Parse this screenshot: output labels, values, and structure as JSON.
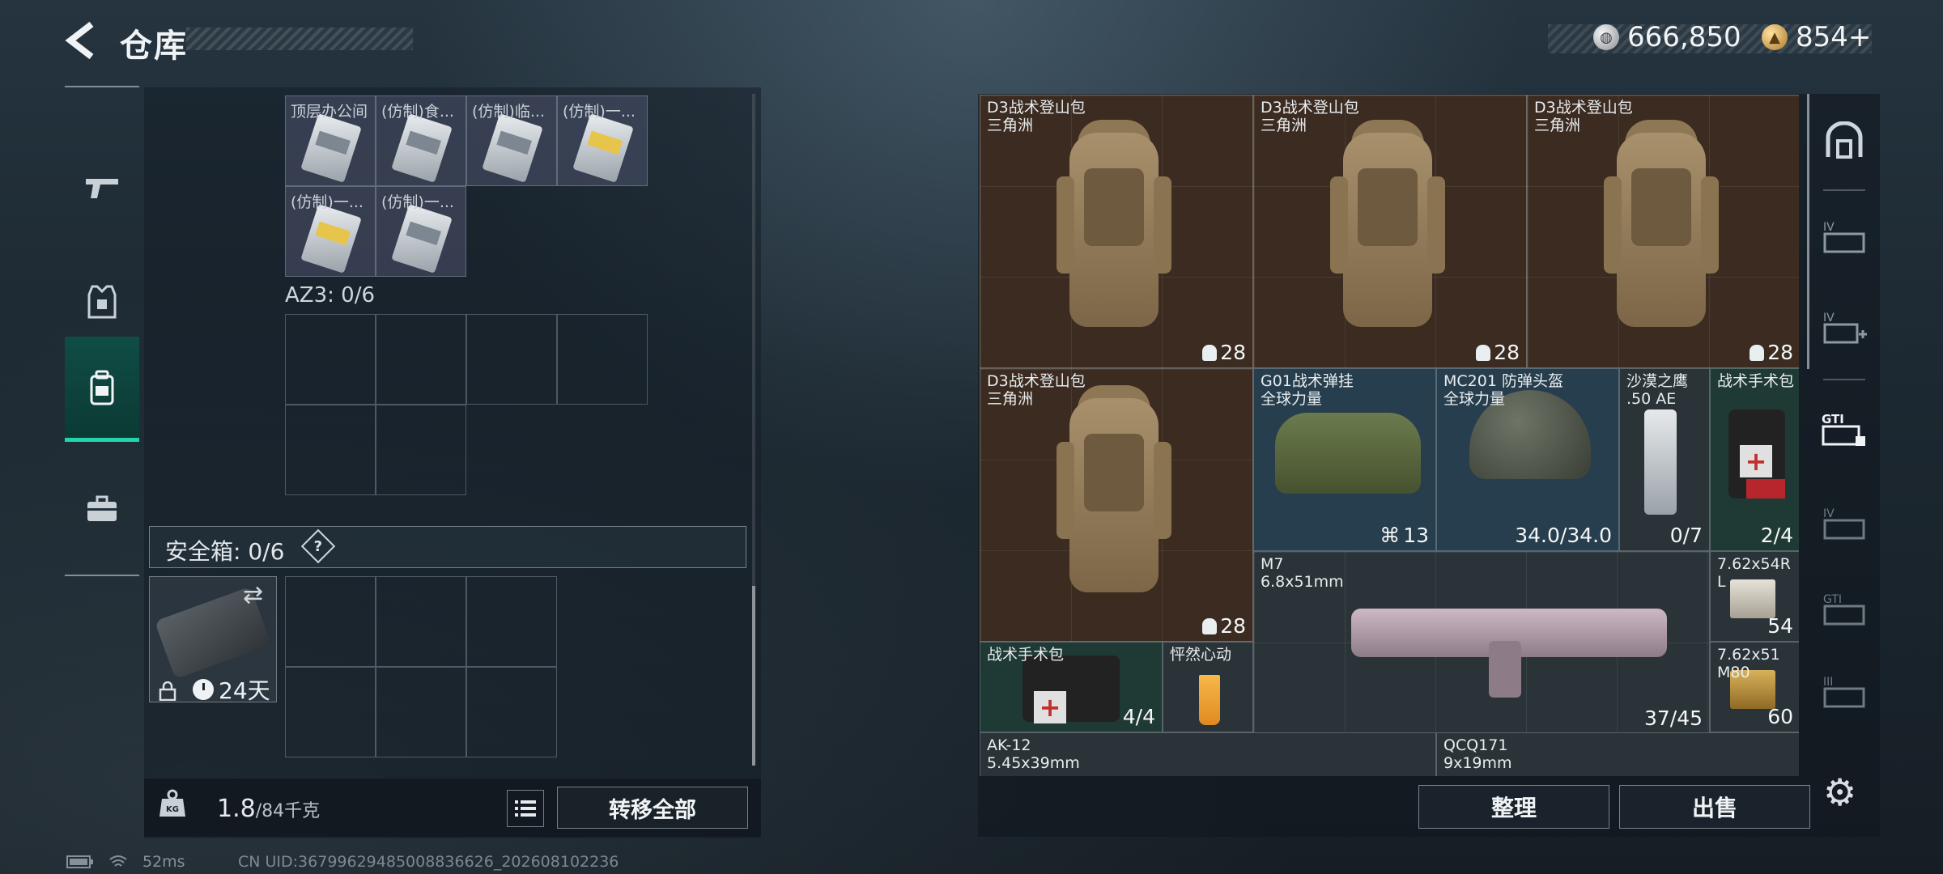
{
  "header": {
    "title": "仓库",
    "currency_silver": "666,850",
    "currency_gold": "854+"
  },
  "sidebar_left": [
    {
      "icon": "rifle-icon"
    },
    {
      "icon": "armor-icon"
    },
    {
      "icon": "backpack-icon",
      "active": true
    },
    {
      "icon": "briefcase-icon"
    }
  ],
  "left_panel": {
    "slots": [
      {
        "label": "顶层办公间",
        "card": "grey"
      },
      {
        "label": "(仿制)食...",
        "card": "grey"
      },
      {
        "label": "(仿制)临...",
        "card": "grey"
      },
      {
        "label": "(仿制)一...",
        "card": "gold"
      },
      {
        "label": "(仿制)一...",
        "card": "gold"
      },
      {
        "label": "(仿制)一...",
        "card": "grey"
      }
    ],
    "az3_label": "AZ3: 0/6",
    "safe_box_label": "安全箱: 0/6",
    "safe_box_help": "?",
    "case_days": "24天",
    "weight_value": "1.8",
    "weight_capacity": "/84千克",
    "transfer_all": "转移全部"
  },
  "right_grid": {
    "items": [
      {
        "name": "D3战术登山包",
        "sub": "三角洲",
        "count": "28"
      },
      {
        "name": "D3战术登山包",
        "sub": "三角洲",
        "count": "28"
      },
      {
        "name": "D3战术登山包",
        "sub": "三角洲",
        "count": "28"
      },
      {
        "name": "D3战术登山包",
        "sub": "三角洲",
        "count": "28"
      },
      {
        "name": "G01战术弹挂",
        "sub": "全球力量",
        "count": "13"
      },
      {
        "name": "MC201 防弹头盔",
        "sub": "全球力量",
        "count": "34.0/34.0"
      },
      {
        "name": "沙漠之鹰",
        "sub": ".50 AE",
        "count": "0/7"
      },
      {
        "name": "战术手术包",
        "sub": "",
        "count": "2/4"
      },
      {
        "name": "M7",
        "sub": "6.8x51mm",
        "count": "37/45"
      },
      {
        "name": "7.62x54R",
        "sub": "L",
        "count": "54"
      },
      {
        "name": "7.62x51",
        "sub": "M80",
        "count": "60"
      },
      {
        "name": "战术手术包",
        "sub": "",
        "count": "4/4"
      },
      {
        "name": "怦然心动",
        "sub": "",
        "count": ""
      },
      {
        "name": "AK-12",
        "sub": "5.45x39mm",
        "count": ""
      },
      {
        "name": "QCQ171",
        "sub": "9x19mm",
        "count": ""
      }
    ]
  },
  "buttons": {
    "sort": "整理",
    "sell": "出售"
  },
  "status_bar": {
    "ping": "52ms",
    "uid": "CN UID:3679962948500883662​6_202608102236"
  },
  "colors": {
    "accent_teal": "#23d3ad",
    "tile_brown": "#3b2b20",
    "tile_blue": "#263e4d",
    "tile_green": "#1f3a34"
  }
}
